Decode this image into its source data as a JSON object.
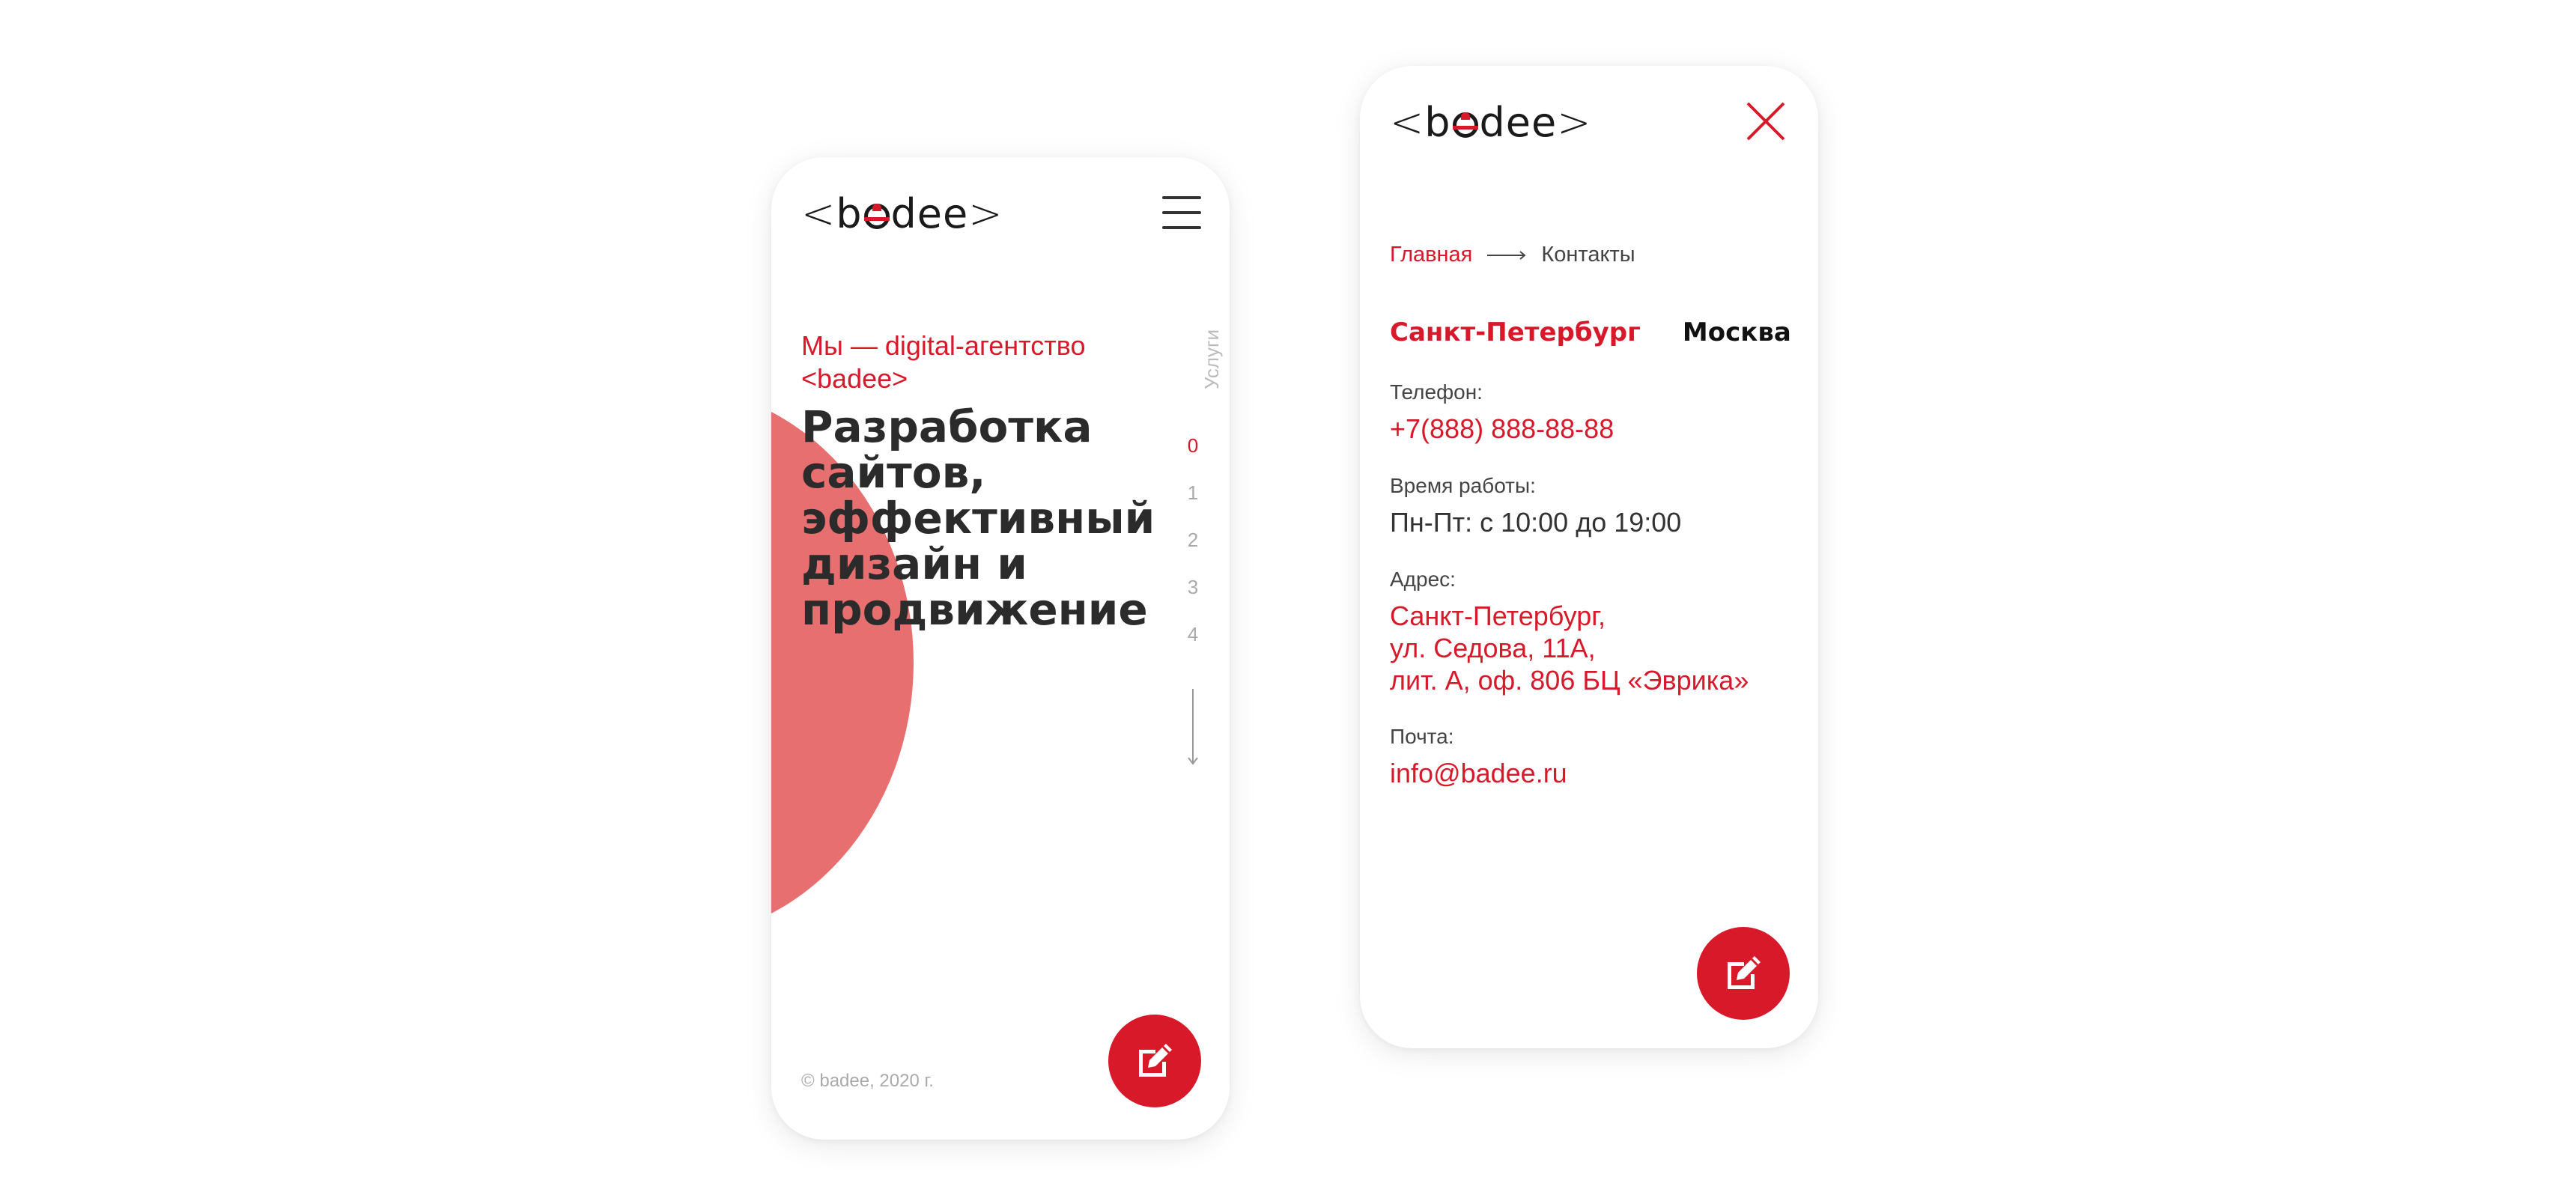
{
  "brand": {
    "logo_text": "<badee>",
    "accent_color": "#d7192a",
    "shape_color": "#e86f70"
  },
  "home": {
    "tagline": "Мы — digital-агентство <badee>",
    "headline": "Разработка сайтов, эффективный дизайн и продвижение",
    "side_nav": {
      "label": "Услуги",
      "items": [
        "0",
        "1",
        "2",
        "3",
        "4"
      ],
      "active_index": 0
    },
    "copyright": "© badee, 2020 г.",
    "menu_icon": "hamburger-icon",
    "fab_icon": "edit-icon"
  },
  "contacts": {
    "breadcrumb": {
      "home": "Главная",
      "current": "Контакты"
    },
    "city_tabs": [
      "Санкт-Петербург",
      "Москва"
    ],
    "active_city": 0,
    "phone_label": "Телефон:",
    "phone": "+7(888) 888-88-88",
    "hours_label": "Время работы:",
    "hours": "Пн-Пт: с 10:00 до 19:00",
    "address_label": "Адрес:",
    "address_lines": [
      "Санкт-Петербург,",
      "ул. Седова, 11А,",
      "лит. А, оф. 806 БЦ «Эврика»"
    ],
    "email_label": "Почта:",
    "email": "info@badee.ru",
    "close_icon": "close-icon",
    "fab_icon": "edit-icon"
  }
}
